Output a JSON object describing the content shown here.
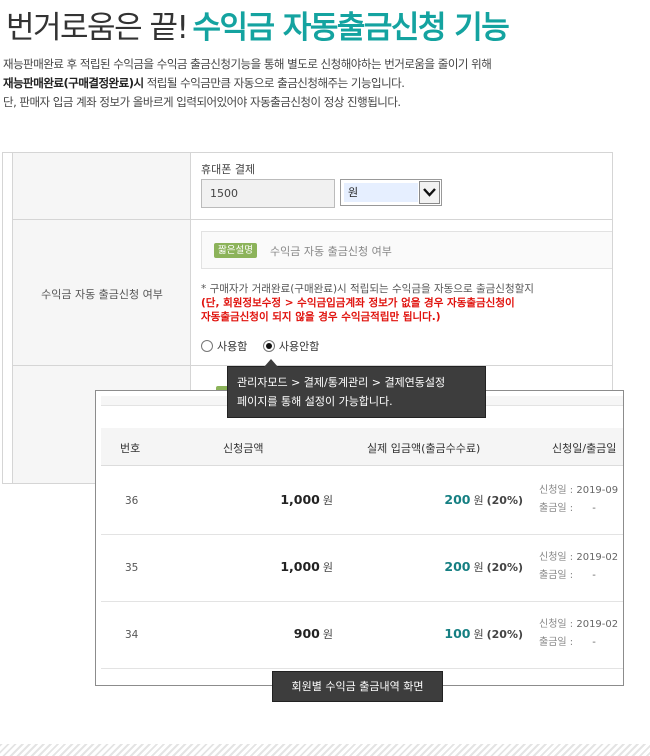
{
  "headline": {
    "dark": "번거로움은 끝!",
    "teal": "수익금 자동출금신청 기능"
  },
  "description": {
    "line1": "재능판매완료 후 적립된 수익금을 수익금 출금신청기능을 통해 별도로 신청해야하는 번거로움을 줄이기 위해",
    "line2_bold": "재능판매완료(구매결정완료)시",
    "line2_rest": " 적립될 수익금만큼 자동으로 출금신청해주는 기능입니다.",
    "line3": "단, 판매자 입금 계좌 정보가 올바르게 입력되어있어야 자동출금신청이 정상 진행됩니다."
  },
  "settings": {
    "payment_label": "휴대폰 결제",
    "amount_value": "1500",
    "unit_selected": "원",
    "row_label": "수익금 자동 출금신청 여부",
    "help_badge": "짧은설명",
    "help_text": "수익금 자동 출금신청 여부",
    "note_line1": "* 구매자가 거래완료(구매완료)시 적립되는 수익금을 자동으로 출금신청할지",
    "note_line2": "(단, 회원정보수정 > 수익금입금계좌 정보가 없을 경우 자동출금신청이",
    "note_line3": "자동출금신청이 되지 않을 경우 수익금적립만 됩니다.)",
    "radio_use": "사용함",
    "radio_nouse": "사용안함",
    "radio_selected": "사용안함"
  },
  "tooltip": {
    "line1": "관리자모드 > 결제/통계관리 > 결제연동설정",
    "line2": "페이지를 통해 설정이 가능합니다."
  },
  "history": {
    "columns": [
      "번호",
      "신청금액",
      "실제 입금액(출금수수료)",
      "신청일/출금일"
    ],
    "date_labels": {
      "request": "신청일",
      "withdraw": "출금일"
    },
    "currency": "원",
    "rows": [
      {
        "no": "36",
        "amount": "1,000",
        "real": "200",
        "fee": "(20%)",
        "request_date": "2019-09",
        "withdraw_date": "-"
      },
      {
        "no": "35",
        "amount": "1,000",
        "real": "200",
        "fee": "(20%)",
        "request_date": "2019-02",
        "withdraw_date": "-"
      },
      {
        "no": "34",
        "amount": "900",
        "real": "100",
        "fee": "(20%)",
        "request_date": "2019-02",
        "withdraw_date": "-"
      }
    ]
  },
  "caption": "회원별 수익금 출금내역 화면",
  "colors": {
    "accent": "#14a3a0",
    "amount_teal": "#157f82",
    "warning_red": "#e0120d",
    "badge_green": "#8cb35a",
    "tooltip_bg": "#3d3d3d"
  }
}
